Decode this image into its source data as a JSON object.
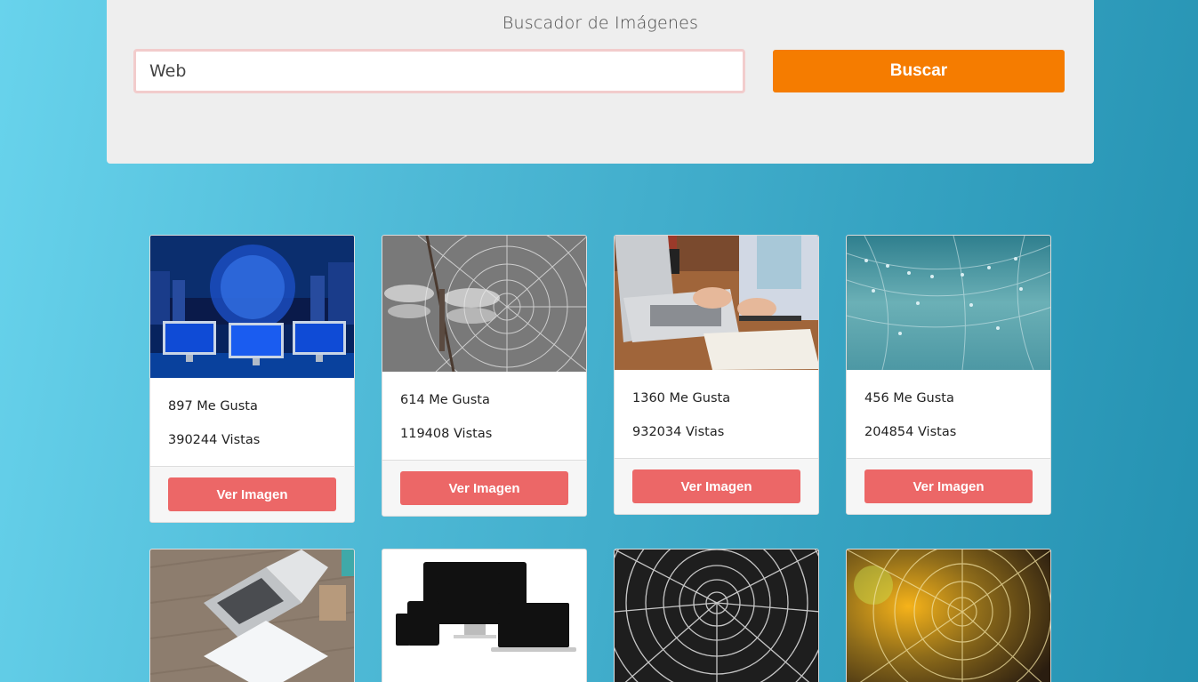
{
  "search": {
    "title": "Buscador de Imágenes",
    "input_value": "Web",
    "button_label": "Buscar"
  },
  "colors": {
    "accent_orange": "#f57c00",
    "button_red": "#ec6767",
    "panel_bg": "#eeeeee",
    "bg_gradient_start": "#68d3ec",
    "bg_gradient_end": "#2491b1"
  },
  "cards": [
    {
      "likes": "897 Me Gusta",
      "views": "390244 Vistas",
      "button": "Ver Imagen",
      "image": "computers-network-city"
    },
    {
      "likes": "614 Me Gusta",
      "views": "119408 Vistas",
      "button": "Ver Imagen",
      "image": "dragonfly-spider-web"
    },
    {
      "likes": "1360 Me Gusta",
      "views": "932034 Vistas",
      "button": "Ver Imagen",
      "image": "person-typing-laptop"
    },
    {
      "likes": "456 Me Gusta",
      "views": "204854 Vistas",
      "button": "Ver Imagen",
      "image": "dewy-web-teal"
    },
    {
      "image": "laptop-on-desk"
    },
    {
      "image": "devices-mockup"
    },
    {
      "image": "spider-web-grey"
    },
    {
      "image": "spider-web-golden"
    }
  ]
}
